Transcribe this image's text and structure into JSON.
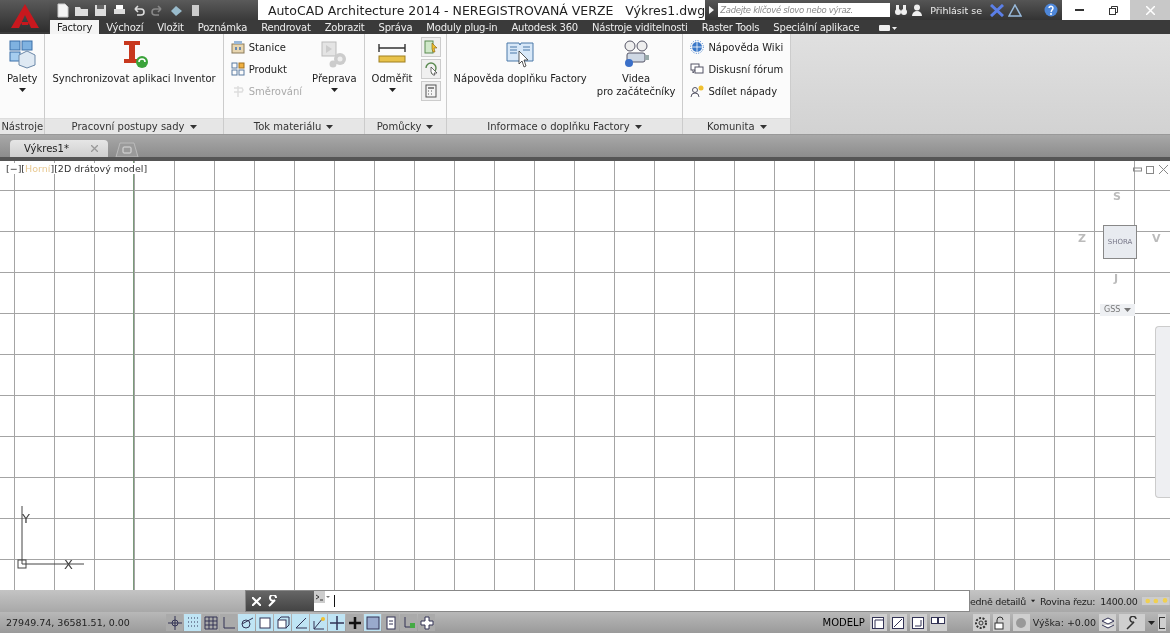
{
  "title_bar": {
    "title": "AutoCAD Architecture 2014 - NEREGISTROVANÁ VERZE   Výkres1.dwg",
    "search": {
      "placeholder": "Zadejte klíčové slovo nebo výraz."
    },
    "sign_in": "Přihlásit se"
  },
  "ribbon_tabs": [
    {
      "label": "Factory",
      "selected": true
    },
    {
      "label": "Výchozí",
      "selected": false
    },
    {
      "label": "Vložit",
      "selected": false
    },
    {
      "label": "Poznámka",
      "selected": false
    },
    {
      "label": "Rendrovat",
      "selected": false
    },
    {
      "label": "Zobrazit",
      "selected": false
    },
    {
      "label": "Správa",
      "selected": false
    },
    {
      "label": "Moduly plug-in",
      "selected": false
    },
    {
      "label": "Autodesk 360",
      "selected": false
    },
    {
      "label": "Nástroje viditelnosti",
      "selected": false
    },
    {
      "label": "Raster Tools",
      "selected": false
    },
    {
      "label": "Speciální aplikace",
      "selected": false
    }
  ],
  "ribbon_panels": [
    {
      "label": "Nástroje",
      "columns": [
        [
          {
            "kind": "large",
            "label": "Palety",
            "dropdown": true,
            "disabled": false
          }
        ]
      ]
    },
    {
      "label": "Pracovní postupy sady",
      "columns": [
        [
          {
            "kind": "large",
            "label": "Synchronizovat aplikaci Inventor",
            "dropdown": false,
            "disabled": false
          }
        ]
      ]
    },
    {
      "label": "Tok materiálu",
      "columns": [
        [
          {
            "kind": "small",
            "label": "Stanice",
            "disabled": false
          },
          {
            "kind": "small",
            "label": "Produkt",
            "disabled": false
          },
          {
            "kind": "small",
            "label": "Směrování",
            "disabled": true
          }
        ],
        [
          {
            "kind": "large",
            "label": "Přeprava",
            "dropdown": true,
            "disabled": false
          }
        ]
      ]
    },
    {
      "label": "Pomůcky",
      "columns": [
        [
          {
            "kind": "large",
            "label": "Odměřit",
            "dropdown": true,
            "disabled": false
          }
        ],
        [
          {
            "kind": "tool",
            "disabled": false
          },
          {
            "kind": "tool",
            "disabled": false
          },
          {
            "kind": "tool",
            "disabled": false
          }
        ]
      ]
    },
    {
      "label": "Informace o doplňku Factory",
      "columns": [
        [
          {
            "kind": "large",
            "label": "Nápověda doplňku Factory",
            "dropdown": false,
            "disabled": false
          }
        ],
        [
          {
            "kind": "large",
            "label": "Videa\npro začátečníky",
            "dropdown": false,
            "disabled": false
          }
        ]
      ]
    },
    {
      "label": "Komunita",
      "columns": [
        [
          {
            "kind": "small",
            "label": "Nápověda Wiki",
            "disabled": false
          },
          {
            "kind": "small",
            "label": "Diskusní fórum",
            "disabled": false
          },
          {
            "kind": "small",
            "label": "Sdílet nápady",
            "disabled": false
          }
        ]
      ]
    }
  ],
  "doc_tabs": [
    {
      "label": "Výkres1*",
      "selected": true
    }
  ],
  "viewport": {
    "label": [
      "[−][",
      "Horní",
      "][2D drátový model]"
    ]
  },
  "viewcube": {
    "top": "SHORA",
    "north": "S",
    "west": "Z",
    "east": "V",
    "south": "J",
    "wcs": "GSS"
  },
  "ucs": {
    "y": "Y",
    "x": "X"
  },
  "annotation_bar": {
    "detail": "edně detailů",
    "cut_plane": "Rovina řezu:",
    "cut_plane_value": "1400.00"
  },
  "status_bar": {
    "coordinates": "27949.74, 36581.51, 0.00",
    "toggles": [
      {
        "kind": "infer",
        "on": false
      },
      {
        "kind": "snap",
        "on": true
      },
      {
        "kind": "grid",
        "on": false
      },
      {
        "kind": "ortho",
        "on": false
      },
      {
        "kind": "polar",
        "on": true
      },
      {
        "kind": "osnap",
        "on": true
      },
      {
        "kind": "cubesnap",
        "on": true
      },
      {
        "kind": "otrack",
        "on": true
      },
      {
        "kind": "ducs",
        "on": true
      },
      {
        "kind": "dyn",
        "on": true
      },
      {
        "kind": "lwt",
        "on": false
      },
      {
        "kind": "tpy",
        "on": true
      },
      {
        "kind": "qp",
        "on": false
      },
      {
        "kind": "sc",
        "on": false
      },
      {
        "kind": "am",
        "on": false
      }
    ],
    "model": "MODELP",
    "elevation": "Výška:",
    "elevation_value": "+0.00"
  }
}
